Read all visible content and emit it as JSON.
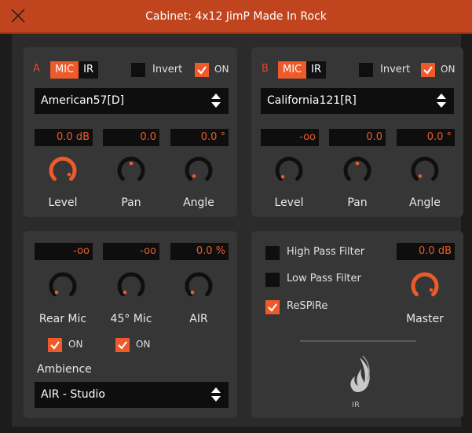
{
  "window": {
    "title": "Cabinet: 4x12 JimP Made In Rock"
  },
  "colors": {
    "accent": "#ef5a2a",
    "titlebar": "#c0441e",
    "panel": "#363636",
    "field": "#0e0e0e"
  },
  "micA": {
    "letter": "A",
    "mic_label": "MIC",
    "ir_label": "IR",
    "invert_label": "Invert",
    "on_label": "ON",
    "mic": "American57[D]",
    "level": {
      "readout": "0.0 dB",
      "label": "Level"
    },
    "pan": {
      "readout": "0.0",
      "label": "Pan"
    },
    "angle": {
      "readout": "0.0 °",
      "label": "Angle"
    }
  },
  "micB": {
    "letter": "B",
    "mic_label": "MIC",
    "ir_label": "IR",
    "invert_label": "Invert",
    "on_label": "ON",
    "mic": "California121[R]",
    "level": {
      "readout": "-oo",
      "label": "Level"
    },
    "pan": {
      "readout": "0.0",
      "label": "Pan"
    },
    "angle": {
      "readout": "0.0 °",
      "label": "Angle"
    }
  },
  "ambience": {
    "rear": {
      "readout": "-oo",
      "label": "Rear Mic",
      "on_label": "ON"
    },
    "m45": {
      "readout": "-oo",
      "label": "45° Mic",
      "on_label": "ON"
    },
    "air": {
      "readout": "0.0 %",
      "label": "AIR"
    },
    "title": "Ambience",
    "preset": "AIR - Studio"
  },
  "filters": {
    "hpf_label": "High Pass Filter",
    "lpf_label": "Low Pass Filter",
    "respire_label": "ReSPiRe",
    "master": {
      "readout": "0.0 dB",
      "label": "Master"
    },
    "logo_text": "IR"
  }
}
